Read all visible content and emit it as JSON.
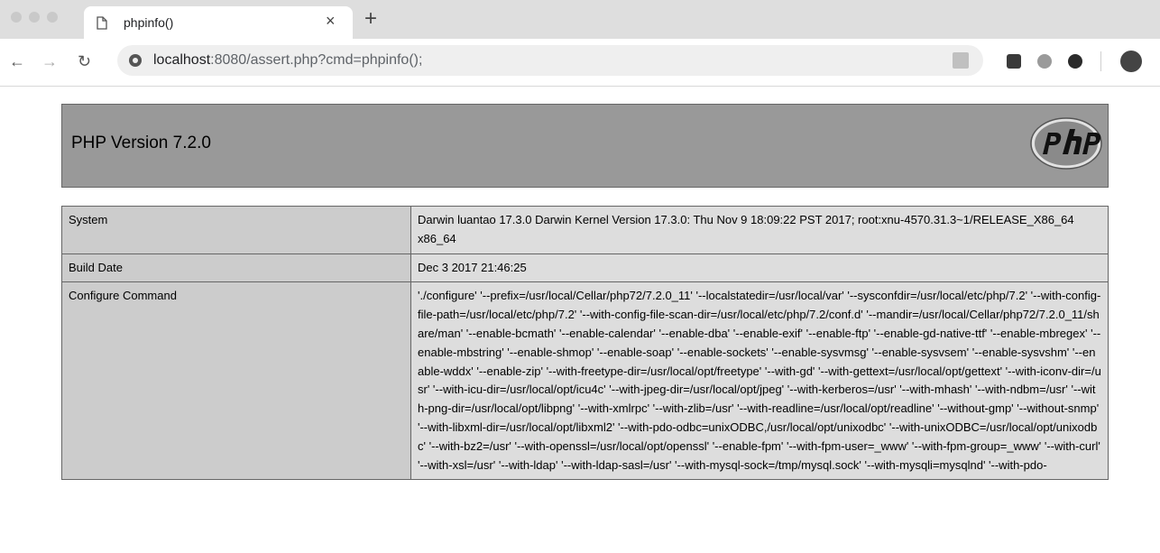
{
  "browser": {
    "tab_title": "phpinfo()",
    "tab_close": "×",
    "new_tab": "+",
    "address_host": "localhost",
    "address_rest": ":8080/assert.php?cmd=phpinfo();"
  },
  "page": {
    "version_title": "PHP Version 7.2.0",
    "rows": [
      {
        "key": "System",
        "value": "Darwin luantao 17.3.0 Darwin Kernel Version 17.3.0: Thu Nov 9 18:09:22 PST 2017; root:xnu-4570.31.3~1/RELEASE_X86_64 x86_64"
      },
      {
        "key": "Build Date",
        "value": "Dec 3 2017 21:46:25"
      },
      {
        "key": "Configure Command",
        "value": "'./configure' '--prefix=/usr/local/Cellar/php72/7.2.0_11' '--localstatedir=/usr/local/var' '--sysconfdir=/usr/local/etc/php/7.2' '--with-config-file-path=/usr/local/etc/php/7.2' '--with-config-file-scan-dir=/usr/local/etc/php/7.2/conf.d' '--mandir=/usr/local/Cellar/php72/7.2.0_11/share/man' '--enable-bcmath' '--enable-calendar' '--enable-dba' '--enable-exif' '--enable-ftp' '--enable-gd-native-ttf' '--enable-mbregex' '--enable-mbstring' '--enable-shmop' '--enable-soap' '--enable-sockets' '--enable-sysvmsg' '--enable-sysvsem' '--enable-sysvshm' '--enable-wddx' '--enable-zip' '--with-freetype-dir=/usr/local/opt/freetype' '--with-gd' '--with-gettext=/usr/local/opt/gettext' '--with-iconv-dir=/usr' '--with-icu-dir=/usr/local/opt/icu4c' '--with-jpeg-dir=/usr/local/opt/jpeg' '--with-kerberos=/usr' '--with-mhash' '--with-ndbm=/usr' '--with-png-dir=/usr/local/opt/libpng' '--with-xmlrpc' '--with-zlib=/usr' '--with-readline=/usr/local/opt/readline' '--without-gmp' '--without-snmp' '--with-libxml-dir=/usr/local/opt/libxml2' '--with-pdo-odbc=unixODBC,/usr/local/opt/unixodbc' '--with-unixODBC=/usr/local/opt/unixodbc' '--with-bz2=/usr' '--with-openssl=/usr/local/opt/openssl' '--enable-fpm' '--with-fpm-user=_www' '--with-fpm-group=_www' '--with-curl' '--with-xsl=/usr' '--with-ldap' '--with-ldap-sasl=/usr' '--with-mysql-sock=/tmp/mysql.sock' '--with-mysqli=mysqlnd' '--with-pdo-"
      }
    ]
  }
}
